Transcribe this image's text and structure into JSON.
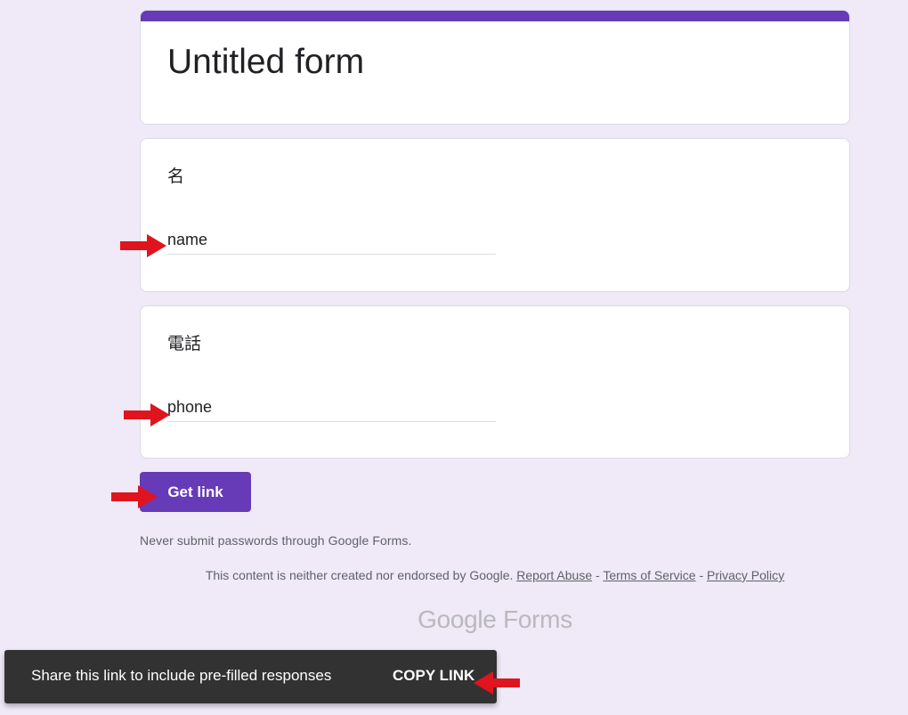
{
  "colors": {
    "page_background": "#efe9f8",
    "accent": "#673ab7",
    "annotation_arrow": "#e0141e",
    "snackbar": "#323232"
  },
  "form": {
    "title": "Untitled form",
    "questions": [
      {
        "title": "名",
        "value": "name"
      },
      {
        "title": "電話",
        "value": "phone"
      }
    ]
  },
  "get_link_button": "Get link",
  "footer": {
    "warning": "Never submit passwords through Google Forms.",
    "disclaimer": "This content is neither created nor endorsed by Google.",
    "links": [
      "Report Abuse",
      "Terms of Service",
      "Privacy Policy"
    ],
    "separator": " - "
  },
  "logo": {
    "brand": "Google",
    "product": "Forms"
  },
  "snackbar": {
    "message": "Share this link to include pre-filled responses",
    "action": "COPY LINK"
  },
  "annotations": {
    "icon": "red-arrow-right-icon",
    "count": 4
  }
}
